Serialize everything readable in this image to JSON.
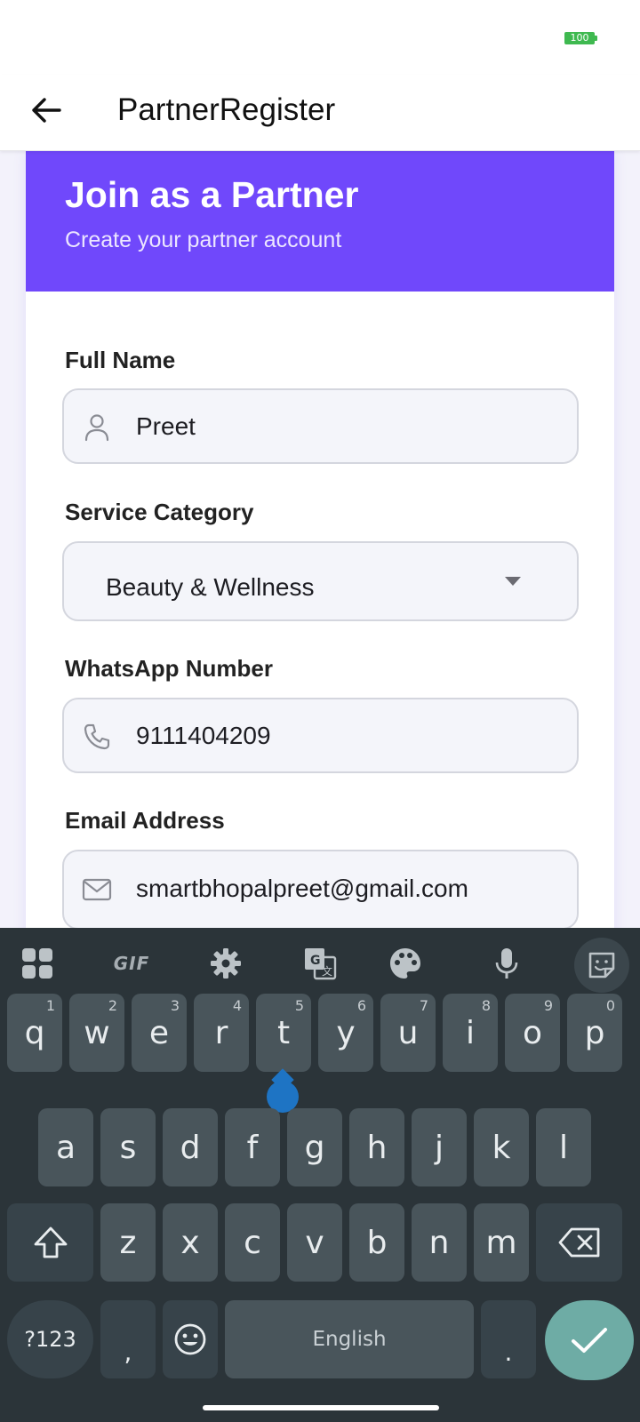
{
  "status_bar": {
    "battery": "100"
  },
  "app_bar": {
    "title": "PartnerRegister",
    "back_icon": "arrow-left-icon"
  },
  "card": {
    "title": "Join as a Partner",
    "subtitle": "Create your partner account",
    "header_color": "#7048fb"
  },
  "form": {
    "full_name": {
      "label": "Full Name",
      "value": "Preet",
      "icon": "person-icon"
    },
    "service_category": {
      "label": "Service Category",
      "value": "Beauty & Wellness",
      "icon": "caret-down-icon"
    },
    "whatsapp": {
      "label": "WhatsApp Number",
      "value": "9111404209",
      "icon": "phone-icon"
    },
    "email": {
      "label": "Email Address",
      "value": "smartbhopalpreet@gmail.com",
      "icon": "mail-icon"
    }
  },
  "keyboard": {
    "toolbar": {
      "gif": "GIF"
    },
    "row1": [
      {
        "key": "q",
        "hint": "1"
      },
      {
        "key": "w",
        "hint": "2"
      },
      {
        "key": "e",
        "hint": "3"
      },
      {
        "key": "r",
        "hint": "4"
      },
      {
        "key": "t",
        "hint": "5"
      },
      {
        "key": "y",
        "hint": "6"
      },
      {
        "key": "u",
        "hint": "7"
      },
      {
        "key": "i",
        "hint": "8"
      },
      {
        "key": "o",
        "hint": "9"
      },
      {
        "key": "p",
        "hint": "0"
      }
    ],
    "row2": [
      "a",
      "s",
      "d",
      "f",
      "g",
      "h",
      "j",
      "k",
      "l"
    ],
    "row3": [
      "z",
      "x",
      "c",
      "v",
      "b",
      "n",
      "m"
    ],
    "symbols_label": "?123",
    "comma": ",",
    "period": ".",
    "space_label": "English",
    "accent_color": "#6eaca5"
  }
}
